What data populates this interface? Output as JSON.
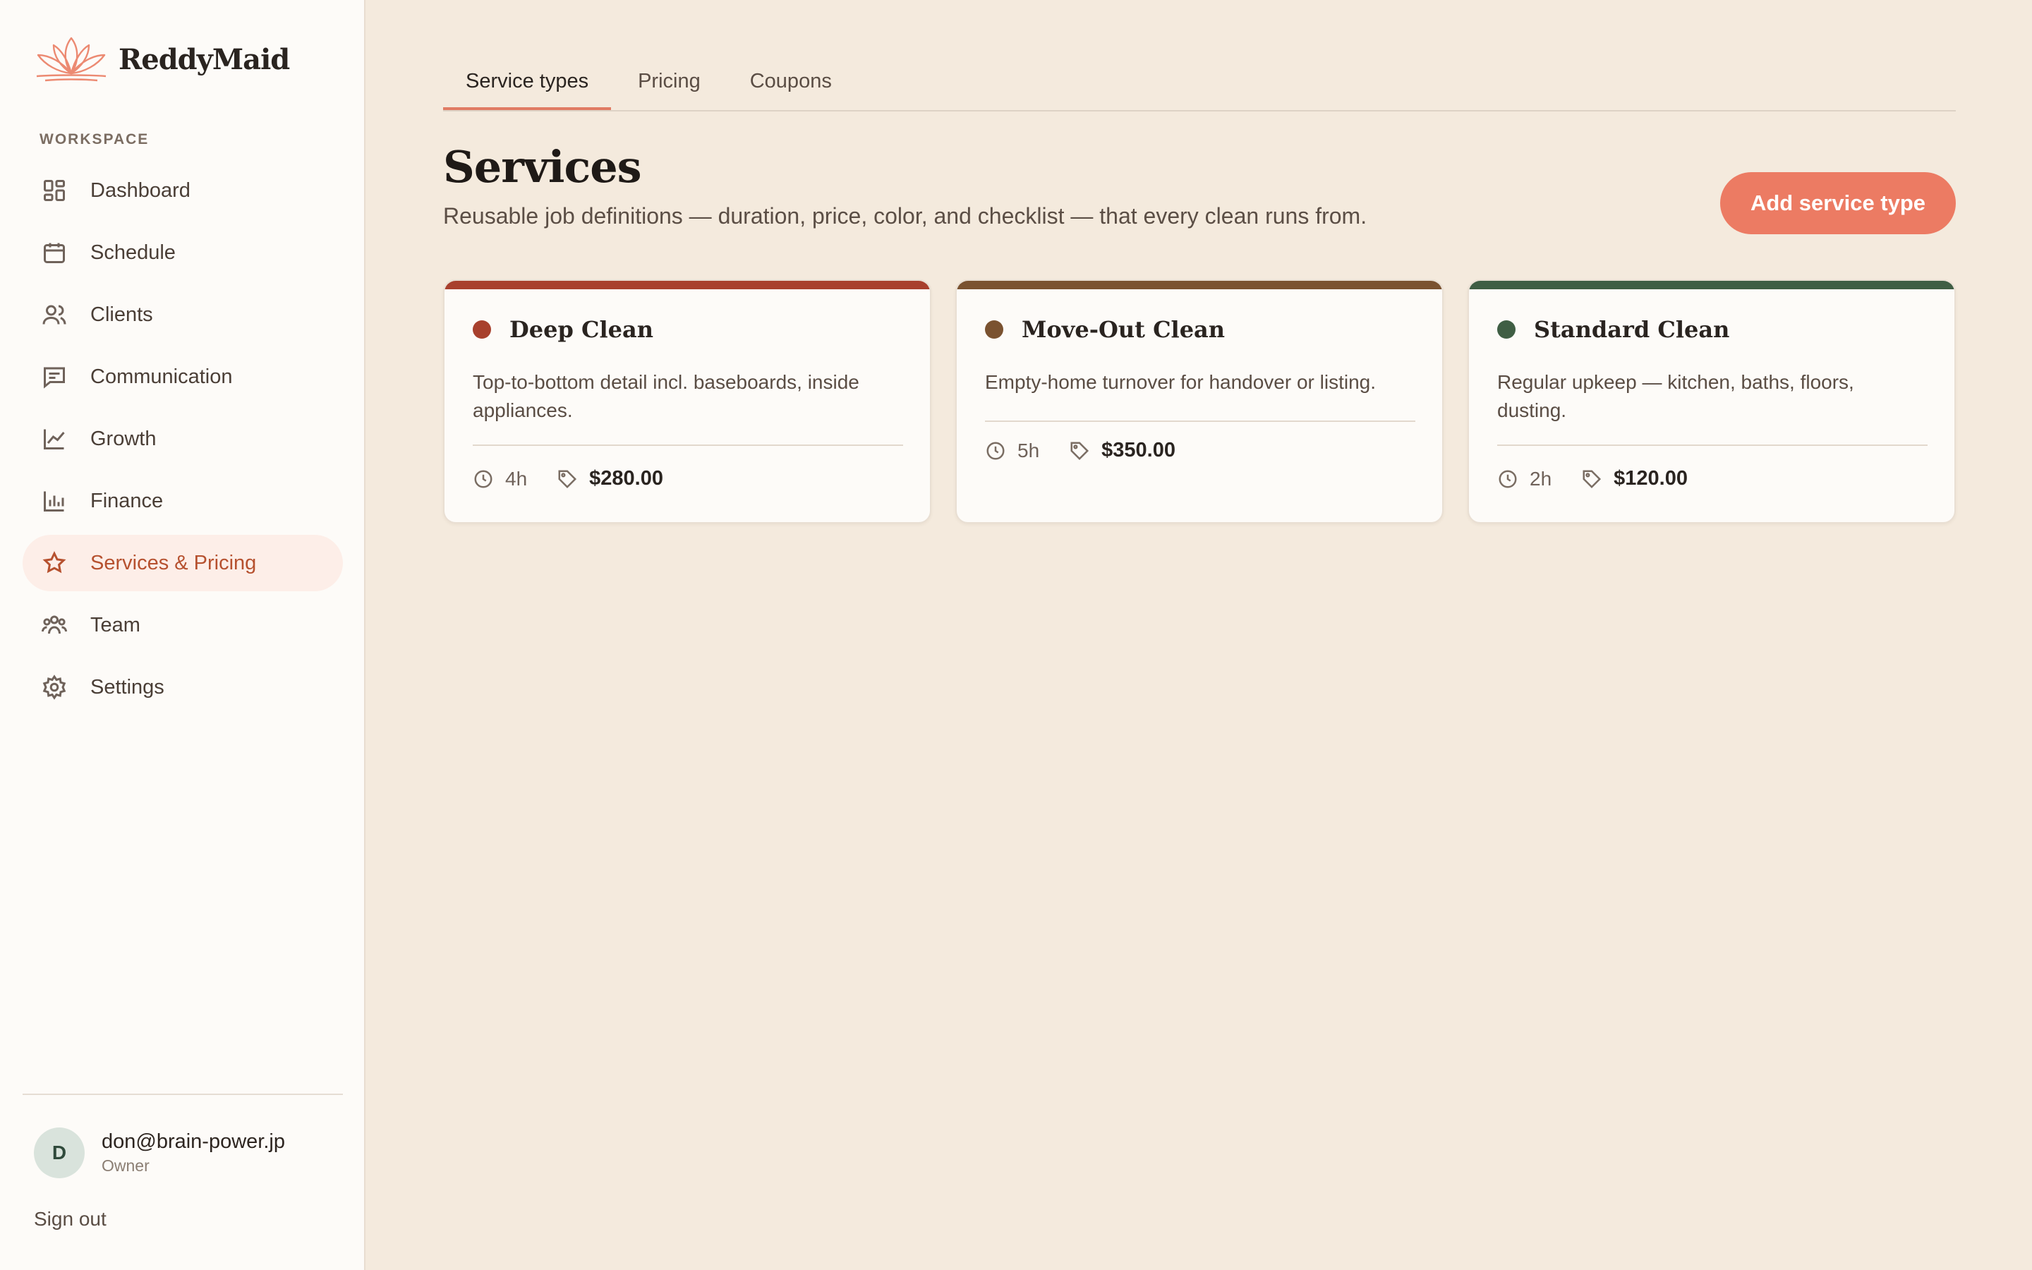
{
  "brand": {
    "name": "ReddyMaid",
    "logo_icon": "lotus-icon",
    "accent": "#ec7b63"
  },
  "sidebar": {
    "section_label": "WORKSPACE",
    "items": [
      {
        "label": "Dashboard",
        "icon": "grid-icon",
        "active": false
      },
      {
        "label": "Schedule",
        "icon": "calendar-icon",
        "active": false
      },
      {
        "label": "Clients",
        "icon": "users-icon",
        "active": false
      },
      {
        "label": "Communication",
        "icon": "message-icon",
        "active": false
      },
      {
        "label": "Growth",
        "icon": "trend-icon",
        "active": false
      },
      {
        "label": "Finance",
        "icon": "bar-chart-icon",
        "active": false
      },
      {
        "label": "Services & Pricing",
        "icon": "star-icon",
        "active": true
      },
      {
        "label": "Team",
        "icon": "team-icon",
        "active": false
      },
      {
        "label": "Settings",
        "icon": "gear-icon",
        "active": false
      }
    ],
    "user": {
      "initial": "D",
      "email": "don@brain-power.jp",
      "role": "Owner"
    },
    "signout_label": "Sign out"
  },
  "tabs": [
    {
      "label": "Service types",
      "active": true
    },
    {
      "label": "Pricing",
      "active": false
    },
    {
      "label": "Coupons",
      "active": false
    }
  ],
  "page": {
    "title": "Services",
    "subtitle": "Reusable job definitions — duration, price, color, and checklist — that every clean runs from.",
    "add_button_label": "Add service type"
  },
  "services": [
    {
      "name": "Deep Clean",
      "color": "#a8402d",
      "description": "Top-to-bottom detail incl. baseboards, inside appliances.",
      "duration": "4h",
      "price": "$280.00"
    },
    {
      "name": "Move-Out Clean",
      "color": "#7a5230",
      "description": "Empty-home turnover for handover or listing.",
      "duration": "5h",
      "price": "$350.00"
    },
    {
      "name": "Standard Clean",
      "color": "#3f5e44",
      "description": "Regular upkeep — kitchen, baths, floors, dusting.",
      "duration": "2h",
      "price": "$120.00"
    }
  ]
}
